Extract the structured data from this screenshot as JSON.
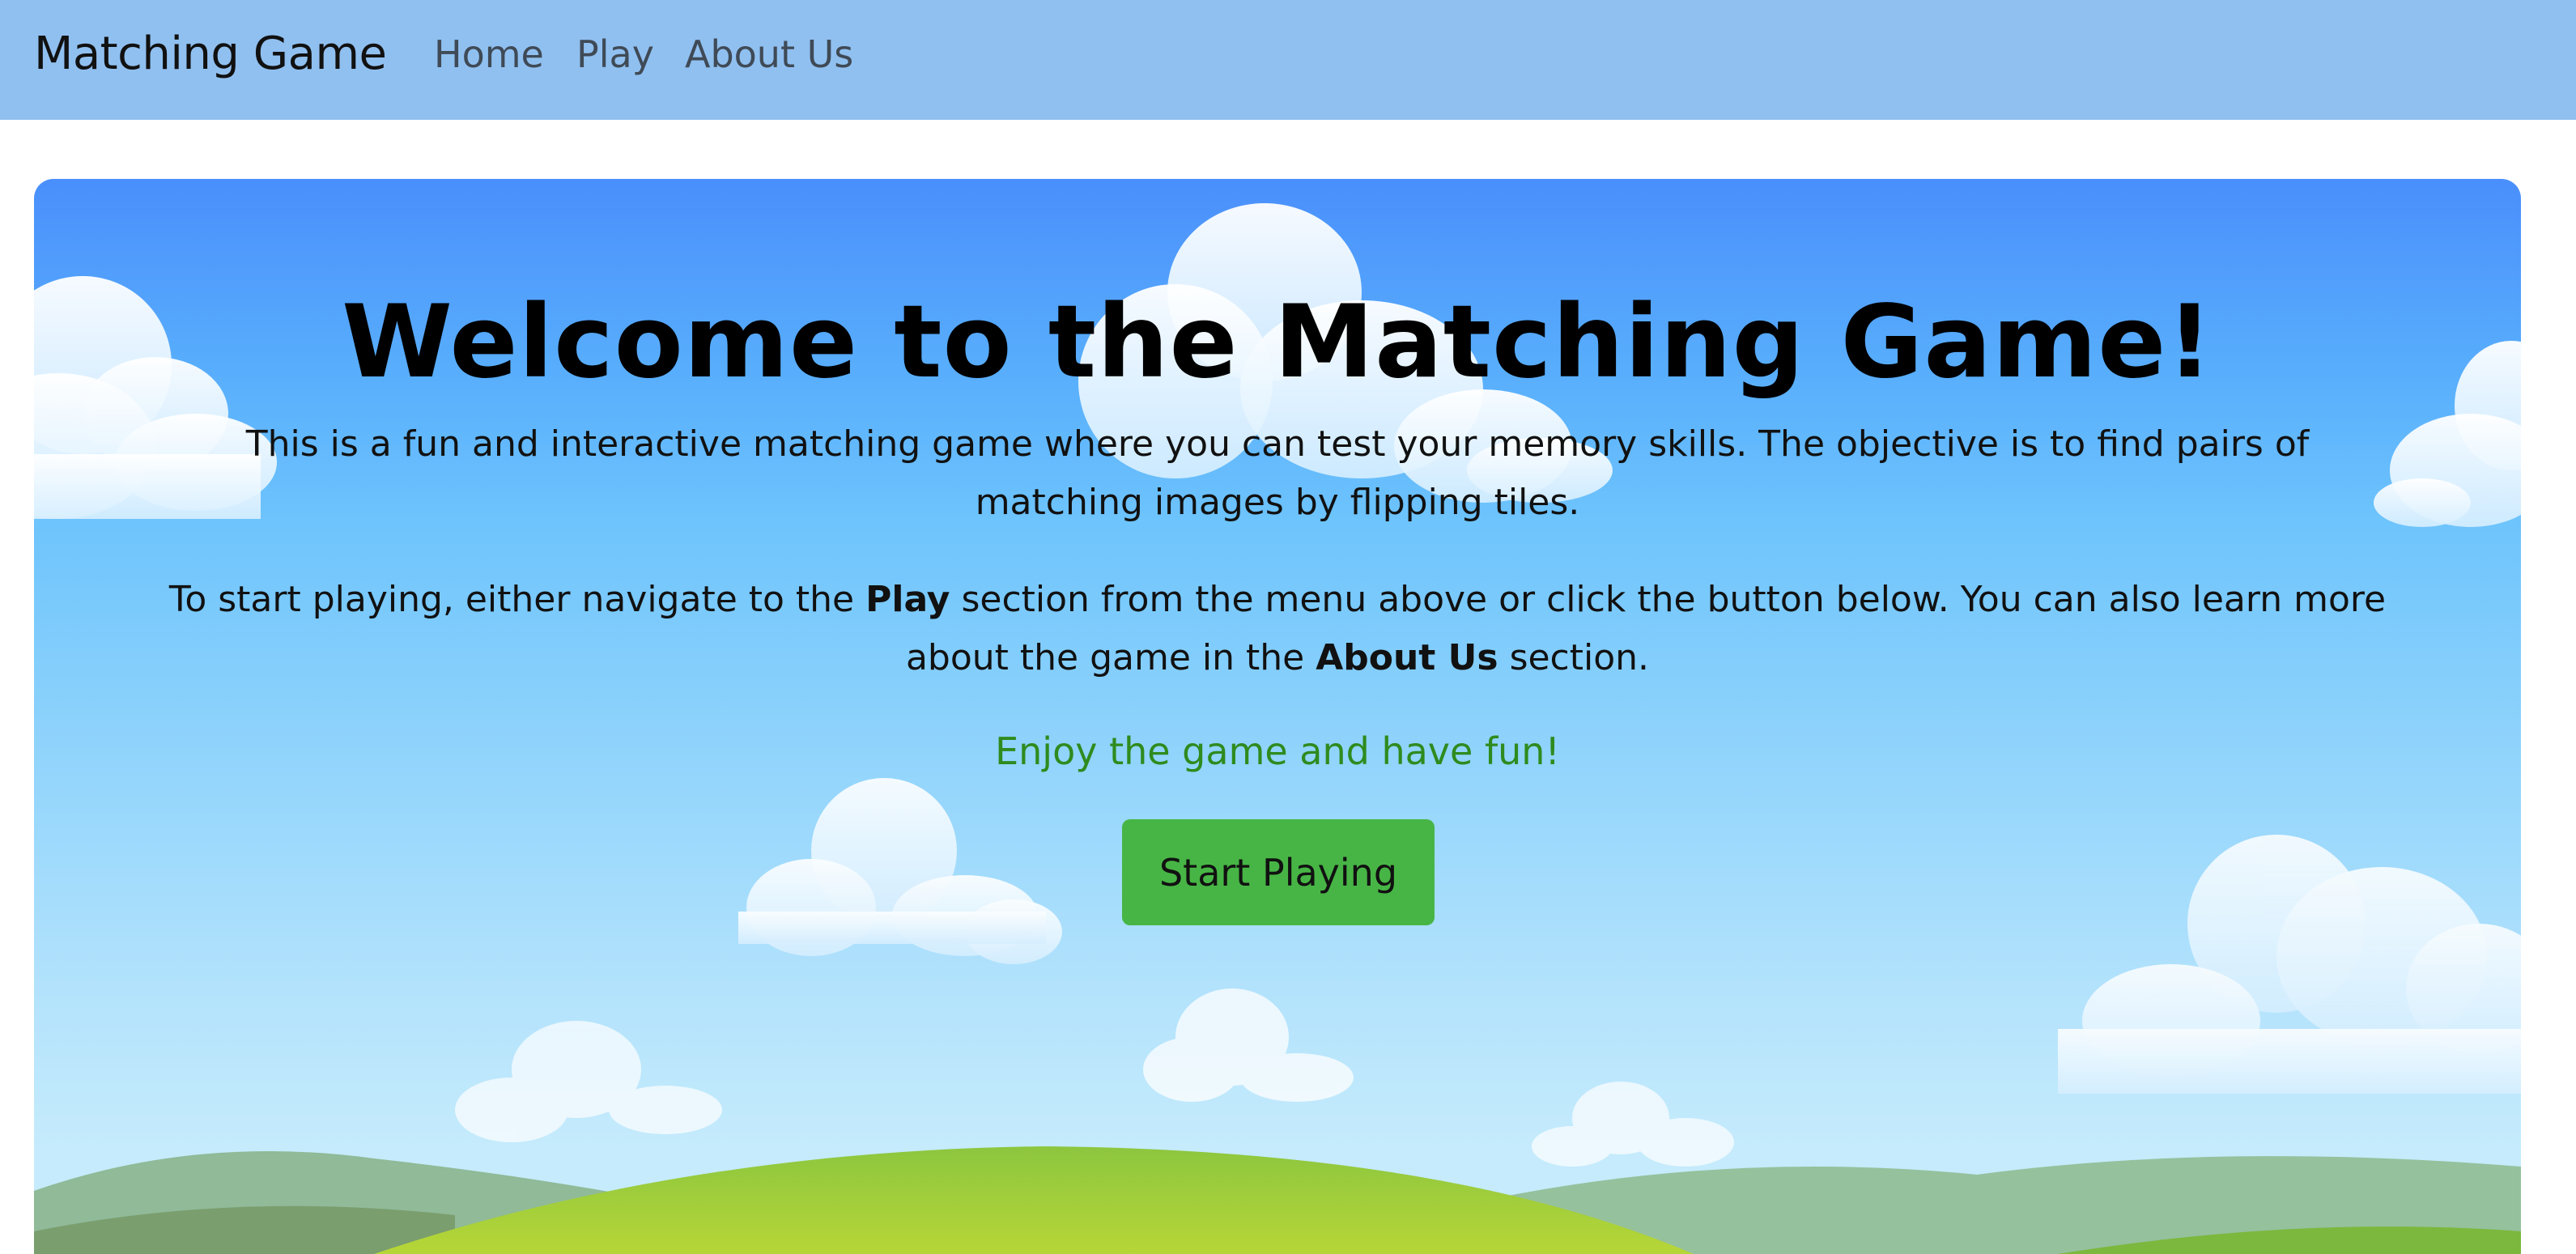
{
  "nav": {
    "brand": "Matching Game",
    "items": [
      {
        "label": "Home"
      },
      {
        "label": "Play"
      },
      {
        "label": "About Us"
      }
    ]
  },
  "hero": {
    "title": "Welcome to the Matching Game!",
    "para1": "This is a fun and interactive matching game where you can test your memory skills. The objective is to find pairs of matching images by flipping tiles.",
    "para2_part1": "To start playing, either navigate to the ",
    "para2_bold1": "Play",
    "para2_part2": " section from the menu above or click the button below. You can also learn more about the game in the ",
    "para2_bold2": "About Us",
    "para2_part3": " section.",
    "enjoy": "Enjoy the game and have fun!",
    "button_label": "Start Playing"
  },
  "colors": {
    "navbar": "#90c0f0",
    "sky_top": "#4a8ffc",
    "sky_bottom": "#c5ebfc",
    "button": "#47b545",
    "enjoy_text": "#2e8b1e"
  }
}
